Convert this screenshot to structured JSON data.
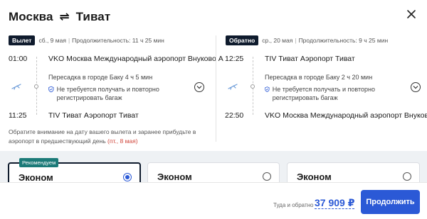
{
  "title": {
    "from": "Москва",
    "arrows": "⇌",
    "to": "Тиват"
  },
  "outbound": {
    "badge": "Вылет",
    "date": "сб., 9 мая",
    "separator": "|",
    "duration": "Продолжительность: 11 ч 25 мин",
    "dep_time": "01:00",
    "dep_station": "VKO Москва Международный аэропорт Внуково А",
    "transfer": "Пересадка в городе Баку  4 ч 5 мин",
    "baggage": "Не требуется получать и повторно регистрировать багаж",
    "arr_time": "11:25",
    "arr_station": "TIV Тиват Аэропорт Тиват"
  },
  "return": {
    "badge": "Обратно",
    "date": "ср., 20 мая",
    "separator": "|",
    "duration": "Продолжительность: 9 ч 25 мин",
    "dep_time": "12:25",
    "dep_station": "TIV Тиват Аэропорт Тиват",
    "transfer": "Пересадка в городе Баку  2 ч 20 мин",
    "baggage": "Не требуется получать и повторно регистрировать багаж",
    "arr_time": "22:50",
    "arr_station": "VKO Москва Международный аэропорт Внуково А"
  },
  "note": {
    "text": "Обратите внимание на дату вашего вылета и заранее прибудьте в аэропорт в предшествующий день ",
    "date": "(пт., 8 мая)"
  },
  "fares": [
    {
      "label": "Эконом",
      "selected": true,
      "recommended": "Рекомендуем"
    },
    {
      "label": "Эконом",
      "selected": false
    },
    {
      "label": "Эконом",
      "selected": false
    }
  ],
  "footer": {
    "total_label": "Туда и обратно",
    "total_price": "37 909 ₽",
    "continue_label": "Продолжить"
  },
  "colors": {
    "accent": "#2b59d6",
    "badge_dark": "#0f1b2d",
    "recommend": "#1b7a78",
    "warning": "#d0463b"
  },
  "icons": [
    "close-icon",
    "plane-icon",
    "shield-icon",
    "chevron-down-icon",
    "swap-arrows-icon"
  ]
}
